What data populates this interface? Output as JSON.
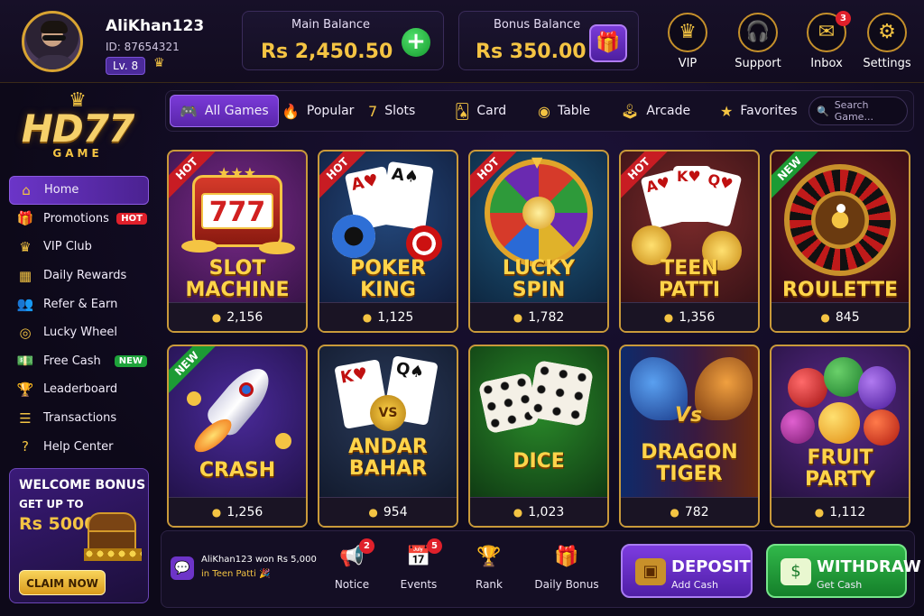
{
  "user": {
    "name": "AliKhan123",
    "id": "ID: 87654321",
    "level": "Lv. 8"
  },
  "balances": {
    "main_label": "Main Balance",
    "main_value": "Rs 2,450.50",
    "bonus_label": "Bonus Balance",
    "bonus_value": "Rs 350.00"
  },
  "header_icons": [
    {
      "label": "VIP",
      "icon": "crown-icon"
    },
    {
      "label": "Support",
      "icon": "headset-icon"
    },
    {
      "label": "Inbox",
      "icon": "mail-icon",
      "badge": "3"
    },
    {
      "label": "Settings",
      "icon": "gear-icon"
    }
  ],
  "logo": {
    "main": "HD77",
    "sub": "GAME"
  },
  "sidebar": {
    "items": [
      {
        "label": "Home",
        "icon": "home-icon"
      },
      {
        "label": "Promotions",
        "icon": "gift-icon",
        "tag": "HOT"
      },
      {
        "label": "VIP Club",
        "icon": "crown-icon"
      },
      {
        "label": "Daily Rewards",
        "icon": "calendar-icon"
      },
      {
        "label": "Refer & Earn",
        "icon": "users-icon"
      },
      {
        "label": "Lucky Wheel",
        "icon": "wheel-icon"
      },
      {
        "label": "Free Cash",
        "icon": "cash-icon",
        "tag": "NEW"
      },
      {
        "label": "Leaderboard",
        "icon": "trophy-icon"
      },
      {
        "label": "Transactions",
        "icon": "list-icon"
      },
      {
        "label": "Help Center",
        "icon": "help-icon"
      }
    ]
  },
  "welcome": {
    "title": "WELCOME BONUS",
    "line2": "GET UP TO",
    "amount": "Rs 5000",
    "cta": "CLAIM NOW"
  },
  "tabs": [
    {
      "label": "All Games",
      "icon": "gamepad-icon"
    },
    {
      "label": "Popular",
      "icon": "fire-icon"
    },
    {
      "label": "Slots",
      "icon": "slots-icon"
    },
    {
      "label": "Card",
      "icon": "card-icon"
    },
    {
      "label": "Table",
      "icon": "chip-icon"
    },
    {
      "label": "Arcade",
      "icon": "arcade-icon"
    },
    {
      "label": "Favorites",
      "icon": "star-icon"
    }
  ],
  "search": {
    "placeholder": "Search Game..."
  },
  "games": [
    {
      "t1": "SLOT",
      "t2": "MACHINE",
      "players": "2,156",
      "ribbon": "HOT"
    },
    {
      "t1": "POKER",
      "t2": "KING",
      "players": "1,125",
      "ribbon": "HOT"
    },
    {
      "t1": "LUCKY",
      "t2": "SPIN",
      "players": "1,782",
      "ribbon": "HOT"
    },
    {
      "t1": "TEEN",
      "t2": "PATTI",
      "players": "1,356",
      "ribbon": "HOT"
    },
    {
      "t1": "ROULETTE",
      "t2": "",
      "players": "845",
      "ribbon": "NEW"
    },
    {
      "t1": "CRASH",
      "t2": "",
      "players": "1,256",
      "ribbon": "NEW"
    },
    {
      "t1": "ANDAR",
      "t2": "BAHAR",
      "players": "954",
      "ribbon": ""
    },
    {
      "t1": "DICE",
      "t2": "",
      "players": "1,023",
      "ribbon": ""
    },
    {
      "t1": "DRAGON",
      "t2": "TIGER",
      "players": "782",
      "ribbon": ""
    },
    {
      "t1": "FRUIT",
      "t2": "PARTY",
      "players": "1,112",
      "ribbon": ""
    }
  ],
  "ticker": {
    "line1": "AliKhan123 won Rs 5,000",
    "line2": "in Teen Patti 🎉"
  },
  "bottom_nav": [
    {
      "label": "Notice",
      "icon": "megaphone-icon",
      "badge": "2"
    },
    {
      "label": "Events",
      "icon": "calendar-star-icon",
      "badge": "5"
    },
    {
      "label": "Rank",
      "icon": "trophy-icon"
    },
    {
      "label": "Daily Bonus",
      "icon": "gift-icon"
    }
  ],
  "deposit": {
    "title": "DEPOSIT",
    "sub": "Add Cash"
  },
  "withdraw": {
    "title": "WITHDRAW",
    "sub": "Get Cash"
  }
}
